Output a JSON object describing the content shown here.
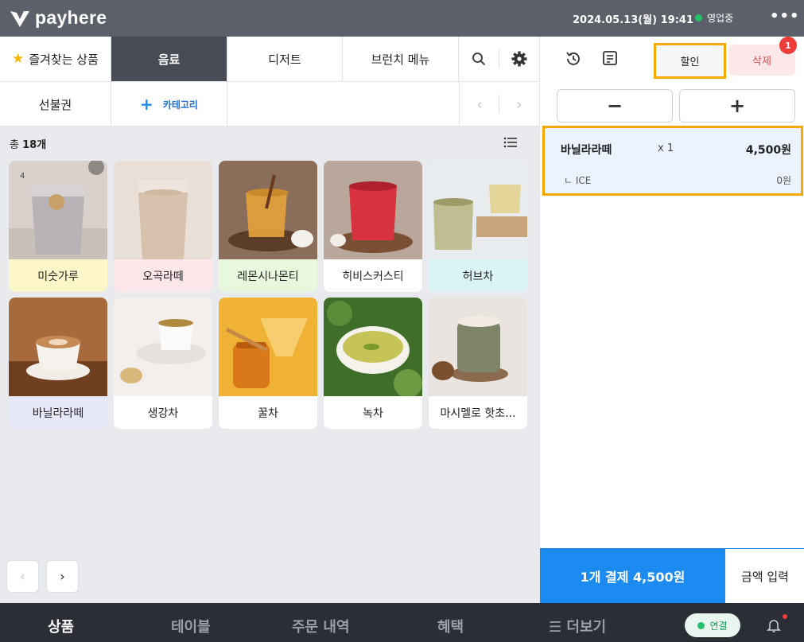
{
  "topbar": {
    "brand": "payhere",
    "datetime": "2024.05.13(월) 19:41",
    "status": "영업중",
    "more": "•••"
  },
  "categories": {
    "favorites": "즐겨찾는 상품",
    "tabs": [
      "음료",
      "디저트",
      "브런치 메뉴"
    ],
    "active_tab": "음료",
    "row2_tab": "선불권",
    "add_category": "카테고리"
  },
  "products": {
    "count_prefix": "총",
    "count": "18개",
    "items": [
      {
        "name": "미숫가루",
        "label_color": "#fdf6c9",
        "stock": "4"
      },
      {
        "name": "오곡라떼",
        "label_color": "#fde6ea"
      },
      {
        "name": "레몬시나몬티",
        "label_color": "#e7f8dd"
      },
      {
        "name": "히비스커스티",
        "label_color": "#ffffff"
      },
      {
        "name": "허브차",
        "label_color": "#daf4f5"
      },
      {
        "name": "바닐라라떼",
        "label_color": "#e8e8fb"
      },
      {
        "name": "생강차",
        "label_color": "#ffffff"
      },
      {
        "name": "꿀차",
        "label_color": "#ffffff"
      },
      {
        "name": "녹차",
        "label_color": "#ffffff"
      },
      {
        "name": "마시멜로 핫초...",
        "label_color": "#ffffff"
      }
    ]
  },
  "order": {
    "discount_label": "할인",
    "delete_label": "삭제",
    "badge": "1",
    "minus": "−",
    "plus": "+",
    "item": {
      "name": "바닐라라떼",
      "qty": "x 1",
      "price": "4,500원",
      "option": "ICE",
      "option_price": "0원"
    },
    "pay_label": "1개 결제  4,500원",
    "amount_label": "금액 입력"
  },
  "bottomnav": {
    "items": [
      "상품",
      "테이블",
      "주문 내역",
      "혜택",
      "더보기"
    ],
    "active": "상품",
    "connect": "연결"
  },
  "colors": {
    "accent_blue": "#1b8bf2",
    "highlight_orange": "#f5a800",
    "topbar": "#5b606a",
    "active_tab": "#474b55"
  }
}
